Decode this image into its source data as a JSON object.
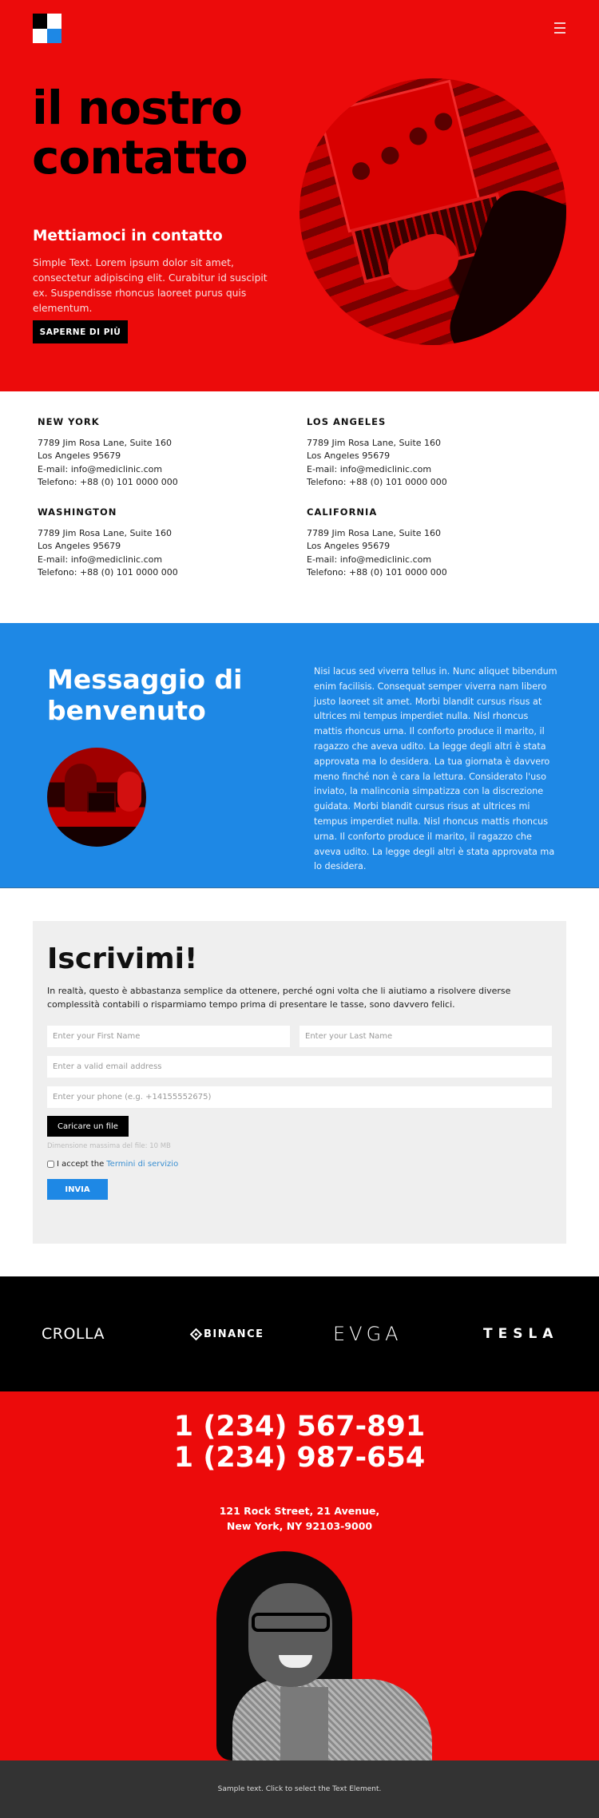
{
  "header": {
    "logo_icon": "four-square-logo",
    "menu_icon": "hamburger-icon"
  },
  "hero": {
    "title_line1": "il nostro",
    "title_line2": "contatto",
    "subtitle": "Mettiamoci in contatto",
    "text": "Simple Text. Lorem ipsum dolor sit amet, consectetur adipiscing elit. Curabitur id suscipit ex. Suspendisse rhoncus laoreet purus quis elementum.",
    "button_label": "SAPERNE DI PIÙ",
    "image": "laptop-typing-photo"
  },
  "addresses": [
    {
      "city": "NEW YORK",
      "street": "7789 Jim Rosa Lane, Suite 160",
      "zip": "Los Angeles 95679",
      "email": "E-mail: info@mediclinic.com",
      "phone": "Telefono: +88 (0) 101 0000 000"
    },
    {
      "city": "LOS ANGELES",
      "street": "7789 Jim Rosa Lane, Suite 160",
      "zip": "Los Angeles 95679",
      "email": "E-mail: info@mediclinic.com",
      "phone": "Telefono: +88 (0) 101 0000 000"
    },
    {
      "city": "WASHINGTON",
      "street": "7789 Jim Rosa Lane, Suite 160",
      "zip": "Los Angeles 95679",
      "email": "E-mail: info@mediclinic.com",
      "phone": "Telefono: +88 (0) 101 0000 000"
    },
    {
      "city": "CALIFORNIA",
      "street": "7789 Jim Rosa Lane, Suite 160",
      "zip": "Los Angeles 95679",
      "email": "E-mail: info@mediclinic.com",
      "phone": "Telefono: +88 (0) 101 0000 000"
    }
  ],
  "welcome": {
    "title_line1": "Messaggio di",
    "title_line2": "benvenuto",
    "image": "office-meeting-photo",
    "text": "Nisi lacus sed viverra tellus in. Nunc aliquet bibendum enim facilisis. Consequat semper viverra nam libero justo laoreet sit amet. Morbi blandit cursus risus at ultrices mi tempus imperdiet nulla. Nisl rhoncus mattis rhoncus urna. Il conforto produce il marito, il ragazzo che aveva udito. La legge degli altri è stata approvata ma lo desidera. La tua giornata è davvero meno finché non è cara la lettura. Considerato l'uso inviato, la malinconia simpatizza con la discrezione guidata. Morbi blandit cursus risus at ultrices mi tempus imperdiet nulla. Nisl rhoncus mattis rhoncus urna. Il conforto produce il marito, il ragazzo che aveva udito. La legge degli altri è stata approvata ma lo desidera."
  },
  "form": {
    "title": "Iscrivimi!",
    "description": "In realtà, questo è abbastanza semplice da ottenere, perché ogni volta che li aiutiamo a risolvere diverse complessità contabili o risparmiamo tempo prima di presentare le tasse, sono davvero felici.",
    "first_name_placeholder": "Enter your First Name",
    "last_name_placeholder": "Enter your Last Name",
    "email_placeholder": "Enter a valid email address",
    "phone_placeholder": "Enter your phone (e.g. +14155552675)",
    "upload_label": "Caricare un file",
    "file_hint": "Dimensione massima del file: 10 MB",
    "terms_prefix": "I accept the",
    "terms_link": "Termini di servizio",
    "terms_checked": false,
    "submit_label": "INVIA"
  },
  "brands": [
    "CROLLA",
    "BINANCE",
    "EVGA",
    "TESLA"
  ],
  "contact": {
    "phone1": "1 (234) 567-891",
    "phone2": "1 (234) 987-654",
    "address_line1": "121 Rock Street, 21 Avenue,",
    "address_line2": "New York, NY 92103-9000",
    "image": "smiling-woman-portrait"
  },
  "footer": {
    "text": "Sample text. Click to select the Text Element."
  },
  "colors": {
    "brand_red": "#ec0b0b",
    "brand_blue": "#1e88e5",
    "form_bg": "#efefef",
    "footer_bg": "#333333"
  }
}
